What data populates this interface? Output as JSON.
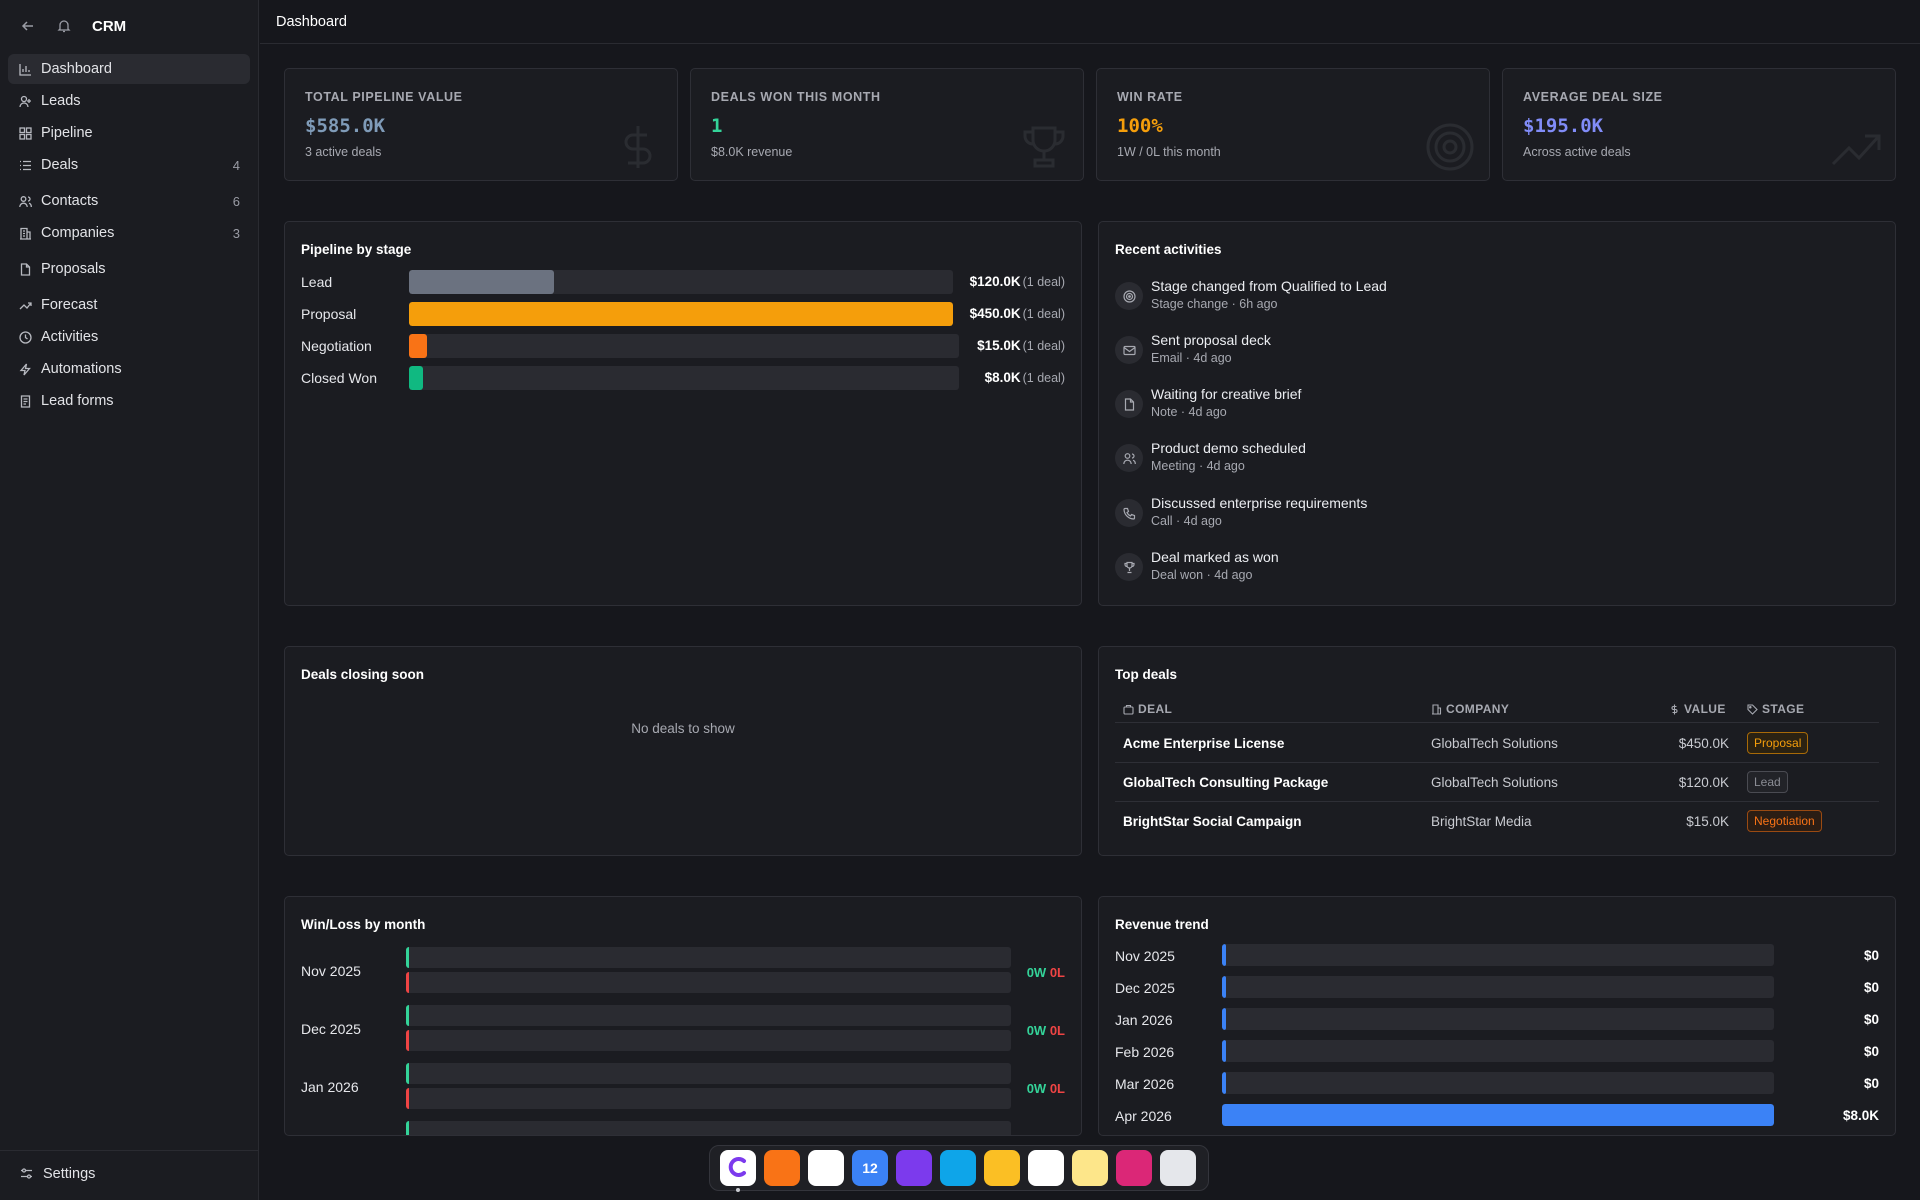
{
  "app": {
    "title": "CRM"
  },
  "sidebar": {
    "items": [
      {
        "label": "Dashboard",
        "icon": "bar-chart-icon",
        "count": ""
      },
      {
        "label": "Leads",
        "icon": "user-plus-icon",
        "count": ""
      },
      {
        "label": "Pipeline",
        "icon": "grid-icon",
        "count": ""
      },
      {
        "label": "Deals",
        "icon": "list-icon",
        "count": "4"
      },
      {
        "label": "Contacts",
        "icon": "users-icon",
        "count": "6"
      },
      {
        "label": "Companies",
        "icon": "building-icon",
        "count": "3"
      },
      {
        "label": "Proposals",
        "icon": "file-icon",
        "count": ""
      },
      {
        "label": "Forecast",
        "icon": "trend-icon",
        "count": ""
      },
      {
        "label": "Activities",
        "icon": "clock-icon",
        "count": ""
      },
      {
        "label": "Automations",
        "icon": "zap-icon",
        "count": ""
      },
      {
        "label": "Lead forms",
        "icon": "form-icon",
        "count": ""
      }
    ],
    "settings_label": "Settings"
  },
  "header": {
    "breadcrumb": "Dashboard"
  },
  "kpis": [
    {
      "label": "TOTAL PIPELINE VALUE",
      "value": "$585.0K",
      "sub": "3 active deals",
      "color": "#7f9bb8",
      "icon": "dollar-icon"
    },
    {
      "label": "DEALS WON THIS MONTH",
      "value": "1",
      "sub": "$8.0K revenue",
      "color": "#34d399",
      "icon": "trophy-icon"
    },
    {
      "label": "WIN RATE",
      "value": "100%",
      "sub": "1W / 0L this month",
      "color": "#f59e0b",
      "icon": "target-icon"
    },
    {
      "label": "AVERAGE DEAL SIZE",
      "value": "$195.0K",
      "sub": "Across active deals",
      "color": "#818cf8",
      "icon": "trend-up-icon"
    }
  ],
  "pipeline": {
    "title": "Pipeline by stage",
    "rows": [
      {
        "stage": "Lead",
        "value": "$120.0K",
        "count": "(1 deal)",
        "amount": 120,
        "color": "#6b7280"
      },
      {
        "stage": "Proposal",
        "value": "$450.0K",
        "count": "(1 deal)",
        "amount": 450,
        "color": "#f59e0b"
      },
      {
        "stage": "Negotiation",
        "value": "$15.0K",
        "count": "(1 deal)",
        "amount": 15,
        "color": "#f97316"
      },
      {
        "stage": "Closed Won",
        "value": "$8.0K",
        "count": "(1 deal)",
        "amount": 8,
        "color": "#10b981"
      }
    ],
    "max": 450
  },
  "activities": {
    "title": "Recent activities",
    "items": [
      {
        "title": "Stage changed from Qualified to Lead",
        "meta": "Stage change · 6h ago",
        "icon": "target-icon"
      },
      {
        "title": "Sent proposal deck",
        "meta": "Email · 4d ago",
        "icon": "mail-icon"
      },
      {
        "title": "Waiting for creative brief",
        "meta": "Note · 4d ago",
        "icon": "note-icon"
      },
      {
        "title": "Product demo scheduled",
        "meta": "Meeting · 4d ago",
        "icon": "users-icon"
      },
      {
        "title": "Discussed enterprise requirements",
        "meta": "Call · 4d ago",
        "icon": "phone-icon"
      },
      {
        "title": "Deal marked as won",
        "meta": "Deal won · 4d ago",
        "icon": "trophy-icon"
      }
    ]
  },
  "closing": {
    "title": "Deals closing soon",
    "empty": "No deals to show"
  },
  "top_deals": {
    "title": "Top deals",
    "headers": {
      "deal": "DEAL",
      "company": "COMPANY",
      "value": "VALUE",
      "stage": "STAGE"
    },
    "rows": [
      {
        "deal": "Acme Enterprise License",
        "company": "GlobalTech Solutions",
        "value": "$450.0K",
        "stage": "Proposal",
        "stage_color": "#f59e0b"
      },
      {
        "deal": "GlobalTech Consulting Package",
        "company": "GlobalTech Solutions",
        "value": "$120.0K",
        "stage": "Lead",
        "stage_color": "#8b8d95"
      },
      {
        "deal": "BrightStar Social Campaign",
        "company": "BrightStar Media",
        "value": "$15.0K",
        "stage": "Negotiation",
        "stage_color": "#f97316"
      }
    ]
  },
  "winloss": {
    "title": "Win/Loss by month",
    "rows": [
      {
        "month": "Nov 2025",
        "won": "0W",
        "lost": "0L"
      },
      {
        "month": "Dec 2025",
        "won": "0W",
        "lost": "0L"
      },
      {
        "month": "Jan 2026",
        "won": "0W",
        "lost": "0L"
      }
    ],
    "won_color": "#34d399",
    "lost_color": "#ef4444"
  },
  "revenue": {
    "title": "Revenue trend",
    "rows": [
      {
        "month": "Nov 2025",
        "value": "$0",
        "amount": 0
      },
      {
        "month": "Dec 2025",
        "value": "$0",
        "amount": 0
      },
      {
        "month": "Jan 2026",
        "value": "$0",
        "amount": 0
      },
      {
        "month": "Feb 2026",
        "value": "$0",
        "amount": 0
      },
      {
        "month": "Mar 2026",
        "value": "$0",
        "amount": 0
      },
      {
        "month": "Apr 2026",
        "value": "$8.0K",
        "amount": 8
      }
    ],
    "max": 8
  },
  "chart_data": [
    {
      "type": "bar",
      "title": "Pipeline by stage",
      "categories": [
        "Lead",
        "Proposal",
        "Negotiation",
        "Closed Won"
      ],
      "values": [
        120000,
        450000,
        15000,
        8000
      ]
    },
    {
      "type": "bar",
      "title": "Revenue trend",
      "categories": [
        "Nov 2025",
        "Dec 2025",
        "Jan 2026",
        "Feb 2026",
        "Mar 2026",
        "Apr 2026"
      ],
      "values": [
        0,
        0,
        0,
        0,
        0,
        8000
      ]
    },
    {
      "type": "bar",
      "title": "Win/Loss by month",
      "categories": [
        "Nov 2025",
        "Dec 2025",
        "Jan 2026"
      ],
      "series": [
        {
          "name": "W",
          "values": [
            0,
            0,
            0
          ]
        },
        {
          "name": "L",
          "values": [
            0,
            0,
            0
          ]
        }
      ]
    }
  ],
  "dock": {
    "apps": [
      {
        "name": "claude-app",
        "color": "#ffffff"
      },
      {
        "name": "affinity-app",
        "color": "#f97316"
      },
      {
        "name": "pages-app",
        "color": "#ffffff"
      },
      {
        "name": "calendar-app",
        "color": "#3b82f6",
        "label": "12"
      },
      {
        "name": "notes-app",
        "color": "#7c3aed"
      },
      {
        "name": "preview-app",
        "color": "#0ea5e9"
      },
      {
        "name": "folder-app",
        "color": "#fbbf24"
      },
      {
        "name": "reminders-app",
        "color": "#ffffff"
      },
      {
        "name": "finder-app",
        "color": "#fde68a"
      },
      {
        "name": "freeform-app",
        "color": "#db2777"
      },
      {
        "name": "settings-app",
        "color": "#e5e7eb"
      }
    ]
  }
}
